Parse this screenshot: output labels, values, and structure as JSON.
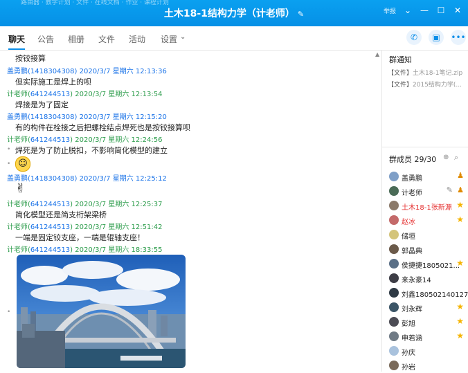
{
  "window": {
    "title": "土木18-1结构力学（计老师）",
    "menu_label": "举报",
    "ticker": "路由器 · 教学计划 · 文件 · 在线文档 · 作业 · 课程计划"
  },
  "tabs": [
    "聊天",
    "公告",
    "相册",
    "文件",
    "活动",
    "设置"
  ],
  "messages": [
    {
      "type": "text",
      "text": "按铰接算"
    },
    {
      "type": "sender",
      "color": "blue",
      "name": "盖勇鹏",
      "qq": "1418304308",
      "time": "2020/3/7 星期六 12:13:36"
    },
    {
      "type": "text",
      "text": "但实际施工是焊上的呗"
    },
    {
      "type": "sender",
      "color": "green",
      "name": "计老师",
      "qq": "641244513",
      "time": "2020/3/7 星期六 12:13:54"
    },
    {
      "type": "text",
      "text": "焊接是为了固定"
    },
    {
      "type": "sender",
      "color": "blue",
      "name": "盖勇鹏",
      "qq": "1418304308",
      "time": "2020/3/7 星期六 12:15:20"
    },
    {
      "type": "text",
      "text": "有的构件在栓接之后把螺栓结点焊死也是按铰接算呗"
    },
    {
      "type": "sender",
      "color": "green",
      "name": "计老师",
      "qq": "641244513",
      "time": "2020/3/7 星期六 12:24:56"
    },
    {
      "type": "text",
      "text": "焊死是为了防止脱扣，不影响简化模型的建立"
    },
    {
      "type": "sender",
      "color": "blue",
      "name": "盖勇鹏",
      "qq": "1418304308",
      "time": "2020/3/7 星期六 12:25:12"
    },
    {
      "type": "sender",
      "color": "green",
      "name": "计老师",
      "qq": "641244513",
      "time": "2020/3/7 星期六 12:25:37"
    },
    {
      "type": "text",
      "text": "简化模型还是简支桁架梁桥"
    },
    {
      "type": "sender",
      "color": "green",
      "name": "计老师",
      "qq": "641244513",
      "time": "2020/3/7 星期六 12:51:42"
    },
    {
      "type": "text",
      "text": "一端是固定铰支座，一端是辊轴支座！"
    },
    {
      "type": "sender",
      "color": "green",
      "name": "计老师",
      "qq": "641244513",
      "time": "2020/3/7 星期六 18:33:55"
    }
  ],
  "notice": {
    "title": "群通知",
    "items": [
      {
        "tag": "【文件】",
        "name": "土木18-1笔记.zip"
      },
      {
        "tag": "【文件】",
        "name": "2015结构力学(..."
      }
    ]
  },
  "members": {
    "title": "群成员",
    "count": "29/30",
    "list": [
      {
        "name": "盖勇鹏",
        "mark": "role"
      },
      {
        "name": "计老师",
        "mark": "edit"
      },
      {
        "name": "土木18-1张新源",
        "mark": "star",
        "red": true
      },
      {
        "name": "赵冰",
        "mark": "star",
        "red": true
      },
      {
        "name": "储垣",
        "mark": ""
      },
      {
        "name": "郭晶典",
        "mark": ""
      },
      {
        "name": "侯捷捷1805021...",
        "mark": "star"
      },
      {
        "name": "来永豪14",
        "mark": ""
      },
      {
        "name": "刘鑫180502140127",
        "mark": ""
      },
      {
        "name": "刘永辉",
        "mark": "star"
      },
      {
        "name": "彭旭",
        "mark": "star"
      },
      {
        "name": "申若涵",
        "mark": "star"
      },
      {
        "name": "孙庆",
        "mark": ""
      },
      {
        "name": "孙岩",
        "mark": ""
      }
    ]
  },
  "icons": {
    "edit": "pencil-icon",
    "phone": "phone-icon",
    "share": "screen-share-icon",
    "more": "more-icon",
    "search": "search-icon",
    "star": "star-icon"
  }
}
